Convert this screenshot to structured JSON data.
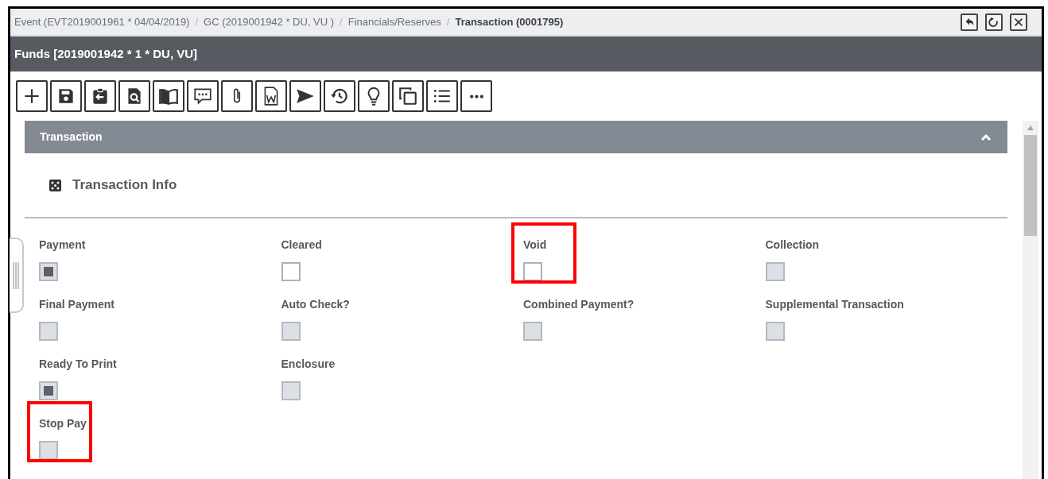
{
  "breadcrumb": [
    {
      "label": "Event (EVT2019001961 * 04/04/2019)",
      "current": false
    },
    {
      "label": "GC (2019001942 * DU, VU )",
      "current": false
    },
    {
      "label": "Financials/Reserves",
      "current": false
    },
    {
      "label": "Transaction (0001795)",
      "current": true
    }
  ],
  "breadcrumb_separator": "/",
  "window_buttons": [
    {
      "kind": "back"
    },
    {
      "kind": "refresh"
    },
    {
      "kind": "close"
    }
  ],
  "title": "Funds [2019001942 * 1 * DU, VU]",
  "toolbar": [
    {
      "kind": "add"
    },
    {
      "kind": "save"
    },
    {
      "kind": "clipboard"
    },
    {
      "kind": "preview"
    },
    {
      "kind": "book"
    },
    {
      "kind": "comment"
    },
    {
      "kind": "attach"
    },
    {
      "kind": "word"
    },
    {
      "kind": "send"
    },
    {
      "kind": "history"
    },
    {
      "kind": "idea"
    },
    {
      "kind": "copy"
    },
    {
      "kind": "list"
    },
    {
      "kind": "more"
    }
  ],
  "panel": {
    "title": "Transaction",
    "expanded": true,
    "section": "Transaction Info",
    "rows": [
      [
        {
          "label": "Payment",
          "checked": true,
          "disabled": true,
          "highlighted": false
        },
        {
          "label": "Cleared",
          "checked": false,
          "disabled": false,
          "highlighted": false
        },
        {
          "label": "Void",
          "checked": false,
          "disabled": false,
          "highlighted": true
        },
        {
          "label": "Collection",
          "checked": false,
          "disabled": true,
          "highlighted": false
        }
      ],
      [
        {
          "label": "Final Payment",
          "checked": false,
          "disabled": true,
          "highlighted": false
        },
        {
          "label": "Auto Check?",
          "checked": false,
          "disabled": true,
          "highlighted": false
        },
        {
          "label": "Combined Payment?",
          "checked": false,
          "disabled": true,
          "highlighted": false
        },
        {
          "label": "Supplemental Transaction",
          "checked": false,
          "disabled": true,
          "highlighted": false
        }
      ],
      [
        {
          "label": "Ready To Print",
          "checked": true,
          "disabled": true,
          "highlighted": false
        },
        {
          "label": "Enclosure",
          "checked": false,
          "disabled": true,
          "highlighted": false
        }
      ],
      [
        {
          "label": "Stop Pay",
          "checked": false,
          "disabled": true,
          "highlighted": true
        }
      ]
    ]
  }
}
